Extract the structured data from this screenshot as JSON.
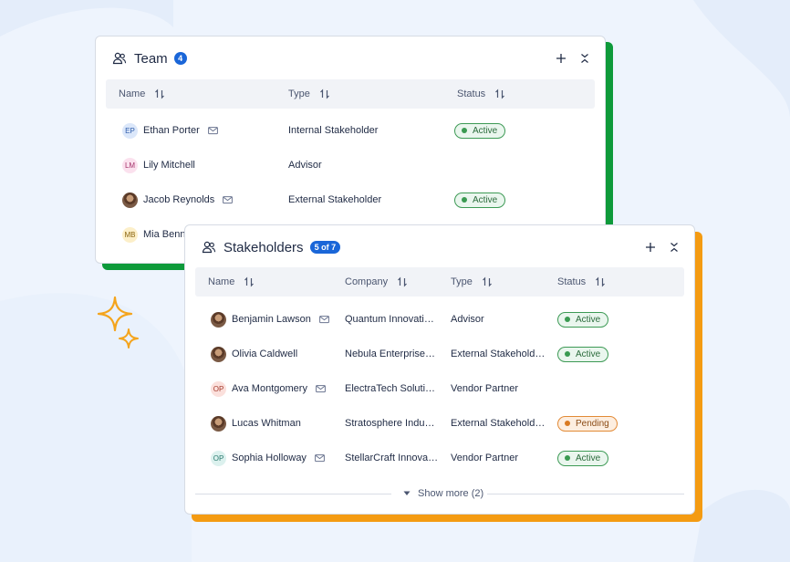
{
  "colors": {
    "background": "#eef4fd",
    "accent": "#1a66d8",
    "team_shadow": "#0e9a3a",
    "stakeholders_shadow": "#f49b12",
    "active": "#3a9a51",
    "pending": "#d97a22",
    "sparkle": "#f4a41c"
  },
  "team": {
    "title": "Team",
    "count": "4",
    "icons": {
      "title_icon": "people-icon",
      "add": "plus-icon",
      "collapse": "collapse-icon"
    },
    "columns": {
      "name": "Name",
      "type": "Type",
      "status": "Status"
    },
    "rows": [
      {
        "initials": "EP",
        "avatar_style": "initials-blue",
        "name": "Ethan Porter",
        "mail": true,
        "type": "Internal Stakeholder",
        "status": "Active"
      },
      {
        "initials": "LM",
        "avatar_style": "initials-pink",
        "name": "Lily Mitchell",
        "mail": false,
        "type": "Advisor",
        "status": ""
      },
      {
        "initials": "",
        "avatar_style": "photo",
        "name": "Jacob Reynolds",
        "mail": true,
        "type": "External Stakeholder",
        "status": "Active"
      },
      {
        "initials": "MB",
        "avatar_style": "initials-yellow",
        "name": "Mia Benne",
        "mail": false,
        "type": "",
        "status": ""
      }
    ]
  },
  "stakeholders": {
    "title": "Stakeholders",
    "count": "5 of 7",
    "icons": {
      "title_icon": "people-icon",
      "add": "plus-icon",
      "collapse": "collapse-icon"
    },
    "columns": {
      "name": "Name",
      "company": "Company",
      "type": "Type",
      "status": "Status"
    },
    "rows": [
      {
        "initials": "",
        "avatar_style": "photo",
        "name": "Benjamin Lawson",
        "mail": true,
        "company": "Quantum Innovati…",
        "type": "Advisor",
        "status": "Active"
      },
      {
        "initials": "",
        "avatar_style": "photo",
        "name": "Olivia Caldwell",
        "mail": false,
        "company": "Nebula Enterprise…",
        "type": "External Stakehold…",
        "status": "Active"
      },
      {
        "initials": "OP",
        "avatar_style": "initials-red",
        "name": "Ava Montgomery",
        "mail": true,
        "company": "ElectraTech Soluti…",
        "type": "Vendor Partner",
        "status": ""
      },
      {
        "initials": "",
        "avatar_style": "photo",
        "name": "Lucas Whitman",
        "mail": false,
        "company": "Stratosphere Indu…",
        "type": "External Stakehold…",
        "status": "Pending"
      },
      {
        "initials": "OP",
        "avatar_style": "initials-teal",
        "name": "Sophia Holloway",
        "mail": true,
        "company": "StellarCraft Innova…",
        "type": "Vendor Partner",
        "status": "Active"
      }
    ],
    "show_more": "Show more (2)"
  }
}
